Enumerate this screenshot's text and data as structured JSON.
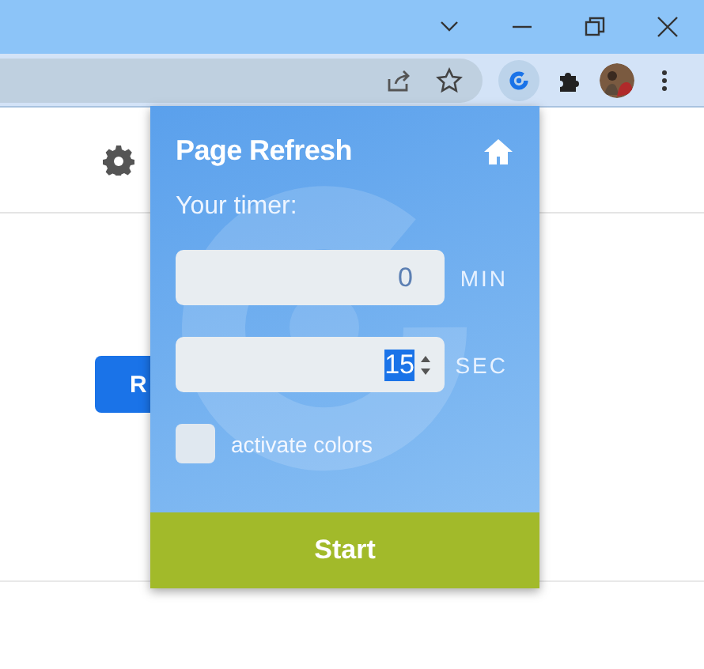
{
  "page": {
    "button": "R"
  },
  "popup": {
    "title": "Page Refresh",
    "timer_label": "Your timer:",
    "fields": [
      {
        "value": "0",
        "unit": "MIN",
        "focused": false
      },
      {
        "value": "15",
        "unit": "SEC",
        "focused": true
      }
    ],
    "checkbox": {
      "label": "activate colors",
      "checked": false
    },
    "button": "Start"
  }
}
